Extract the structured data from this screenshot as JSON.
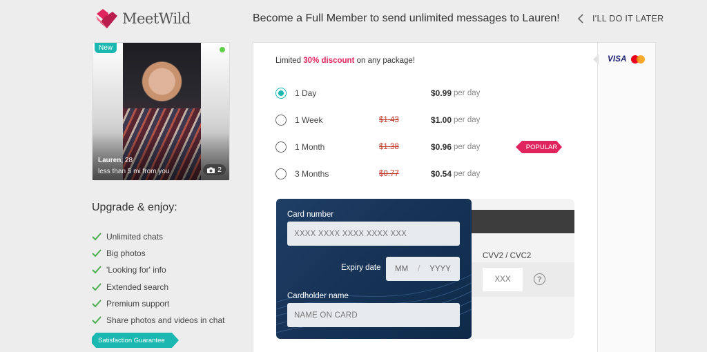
{
  "header": {
    "logo_text": "MeetWild",
    "headline": "Become a Full Member to send unlimited messages to Lauren!",
    "later_label": "I'LL DO IT LATER"
  },
  "profile": {
    "badge": "New",
    "name": "Lauren",
    "age": ", 28",
    "distance": "less than 5 mi from you",
    "photo_count": "2",
    "online": true
  },
  "upgrade": {
    "title": "Upgrade & enjoy:",
    "benefits": [
      "Unlimited chats",
      "Big photos",
      "'Looking for' info",
      "Extended search",
      "Premium support",
      "Share photos and videos in chat"
    ],
    "guarantee": "Satisfaction Guarantee"
  },
  "promo": {
    "prefix": "Limited ",
    "highlight": "30% discount",
    "suffix": " on any package!"
  },
  "plans": [
    {
      "label": "1 Day",
      "old_price": "",
      "price": "$0.99",
      "per": "per day",
      "selected": true
    },
    {
      "label": "1 Week",
      "old_price": "$1.43",
      "price": "$1.00",
      "per": "per day",
      "selected": false
    },
    {
      "label": "1 Month",
      "old_price": "$1.38",
      "price": "$0.96",
      "per": "per day",
      "selected": false
    },
    {
      "label": "3 Months",
      "old_price": "$0.77",
      "price": "$0.54",
      "per": "per day",
      "selected": false
    }
  ],
  "popular_label": "POPULAR",
  "payment_logos": {
    "visa": "VISA",
    "mastercard_colors": [
      "#eb001b",
      "#f79e1b"
    ]
  },
  "card": {
    "number_label": "Card number",
    "number_placeholder": "XXXX XXXX XXXX XXXX XXX",
    "expiry_label": "Expiry date",
    "expiry_mm": "MM",
    "expiry_sep": "/",
    "expiry_yyyy": "YYYY",
    "holder_label": "Cardholder name",
    "holder_placeholder": "NAME ON CARD",
    "cvv_label": "CVV2 / CVC2",
    "cvv_placeholder": "XXX",
    "help_symbol": "?"
  },
  "colors": {
    "accent": "#1ab8b0",
    "brand_pink": "#e0245e",
    "card_blue": "#183458"
  }
}
